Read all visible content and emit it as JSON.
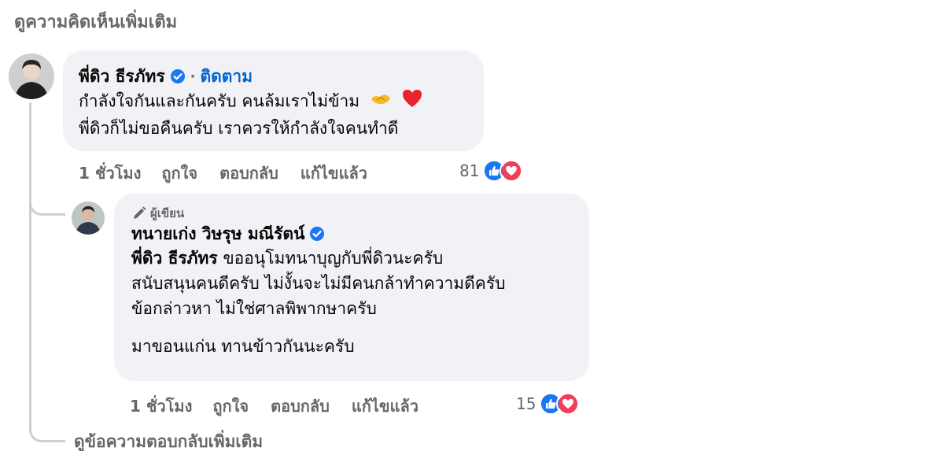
{
  "view_more_comments": "ดูความคิดเห็นเพิ่มเติม",
  "comment": {
    "author": "พี่ดิว ธีรภัทร",
    "separator": "·",
    "follow_label": "ติดตาม",
    "lines": [
      "กำลังใจกันและกันครับ คนล้มเราไม่ข้าม",
      "พี่ดิวก็ไม่ขอคืนครับ เราควรให้กำลังใจคนทำดี"
    ],
    "time": "1 ชั่วโมง",
    "like_label": "ถูกใจ",
    "reply_label": "ตอบกลับ",
    "edited_label": "แก้ไขแล้ว",
    "reaction_count": "81",
    "emoji_icons": [
      "handshake-icon",
      "red-heart-icon"
    ]
  },
  "reply": {
    "badge": "ผู้เขียน",
    "author": "ทนายเก่ง วิษรุษ มณีรัตน์",
    "mention": "พี่ดิว ธีรภัทร",
    "line1_rest": " ขออนุโมทนาบุญกับพี่ดิวนะครับ",
    "line2": "สนับสนุนคนดีครับ ไม่งั้นจะไม่มีคนกล้าทำความดีครับ",
    "line3": "ข้อกล่าวหา ไม่ใช่ศาลพิพากษาครับ",
    "line4": "มาขอนแก่น ทานข้าวกันนะครับ",
    "time": "1 ชั่วโมง",
    "like_label": "ถูกใจ",
    "reply_label": "ตอบกลับ",
    "edited_label": "แก้ไขแล้ว",
    "reaction_count": "15"
  },
  "view_more_replies": "ดูข้อความตอบกลับเพิ่มเติม",
  "colors": {
    "link_blue": "#0064d1",
    "verified_blue": "#1877f2",
    "like_blue": "#1877f2",
    "love_red": "#f33e58",
    "bubble_bg": "#f0f2f5",
    "secondary_text": "#65676b"
  }
}
